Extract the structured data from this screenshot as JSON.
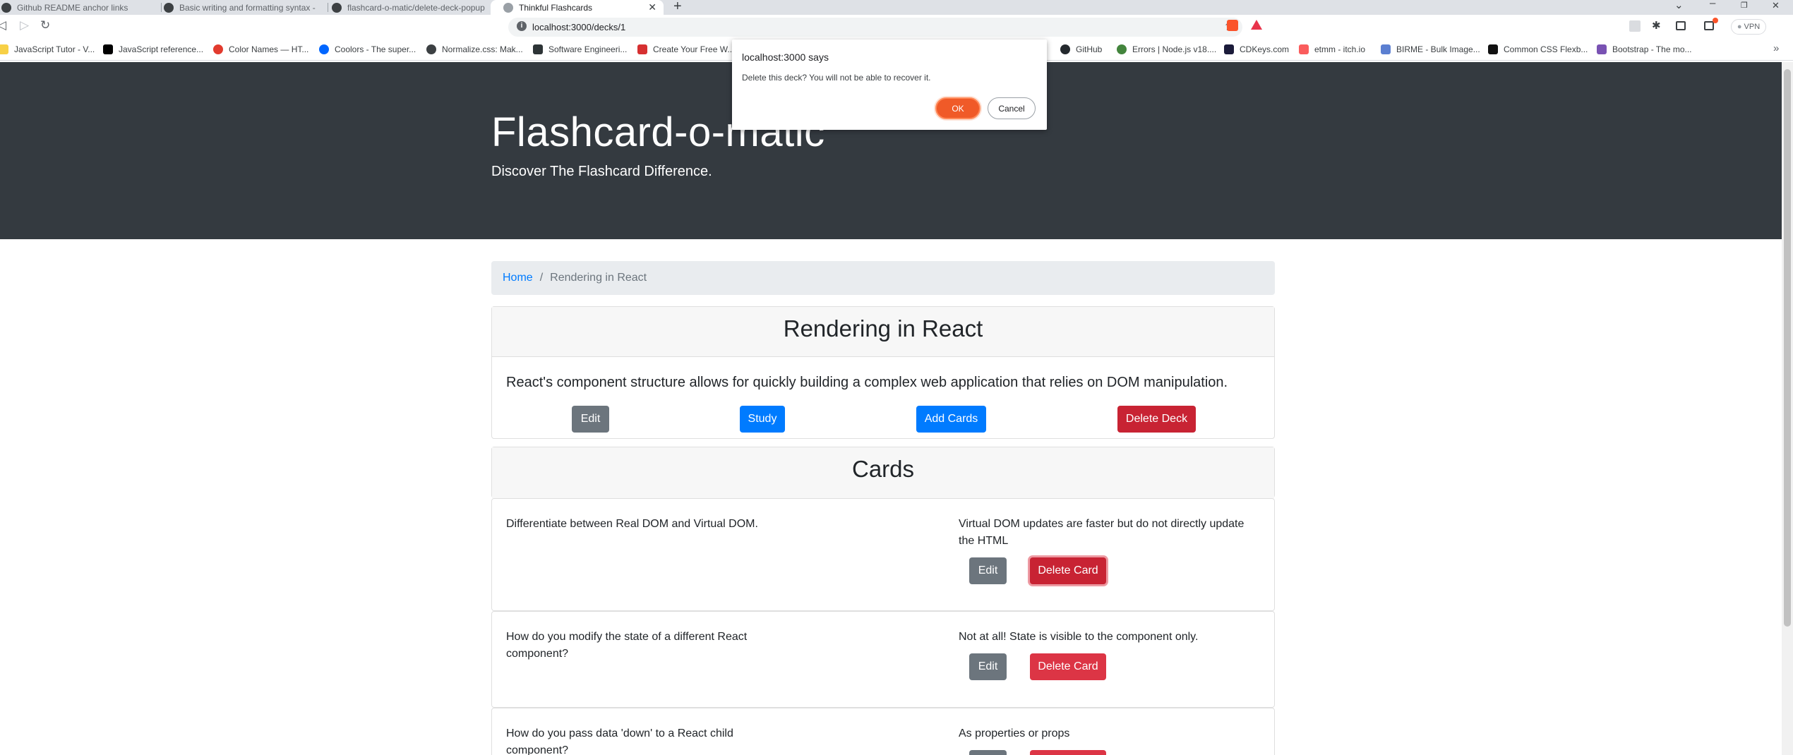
{
  "browser": {
    "tabs": [
      {
        "title": "Github README anchor links",
        "active": false
      },
      {
        "title": "Basic writing and formatting syntax -",
        "active": false
      },
      {
        "title": "flashcard-o-matic/delete-deck-popup",
        "active": false
      },
      {
        "title": "Thinkful Flashcards",
        "active": true
      }
    ],
    "url": "localhost:3000/decks/1",
    "vpn_label": "VPN",
    "bookmarks": [
      "JavaScript Tutor - V...",
      "JavaScript reference...",
      "Color Names — HT...",
      "Coolors - The super...",
      "Normalize.css: Mak...",
      "Software Engineeri...",
      "Create Your Free W...",
      "GitHub",
      "Errors | Node.js v18....",
      "CDKeys.com",
      "etmm - itch.io",
      "BIRME - Bulk Image...",
      "Common CSS Flexb...",
      "Bootstrap - The mo..."
    ]
  },
  "header": {
    "title": "Flashcard-o-matic",
    "lead": "Discover The Flashcard Difference."
  },
  "breadcrumb": {
    "home": "Home",
    "current": "Rendering in React"
  },
  "deck": {
    "name": "Rendering in React",
    "description": "React's component structure allows for quickly building a complex web application that relies on DOM manipulation.",
    "buttons": {
      "edit": "Edit",
      "study": "Study",
      "add_cards": "Add Cards",
      "delete_deck": "Delete Deck"
    }
  },
  "cards_section": {
    "title": "Cards",
    "edit_label": "Edit",
    "delete_label": "Delete Card",
    "items": [
      {
        "front": "Differentiate between Real DOM and Virtual DOM.",
        "back": "Virtual DOM updates are faster but do not directly update the HTML"
      },
      {
        "front": "How do you modify the state of a different React component?",
        "back": "Not at all! State is visible to the component only."
      },
      {
        "front": "How do you pass data 'down' to a React child component?",
        "back": "As properties or props"
      }
    ]
  },
  "dialog": {
    "origin": "localhost:3000 says",
    "message": "Delete this deck? You will not be able to recover it.",
    "ok": "OK",
    "cancel": "Cancel"
  }
}
